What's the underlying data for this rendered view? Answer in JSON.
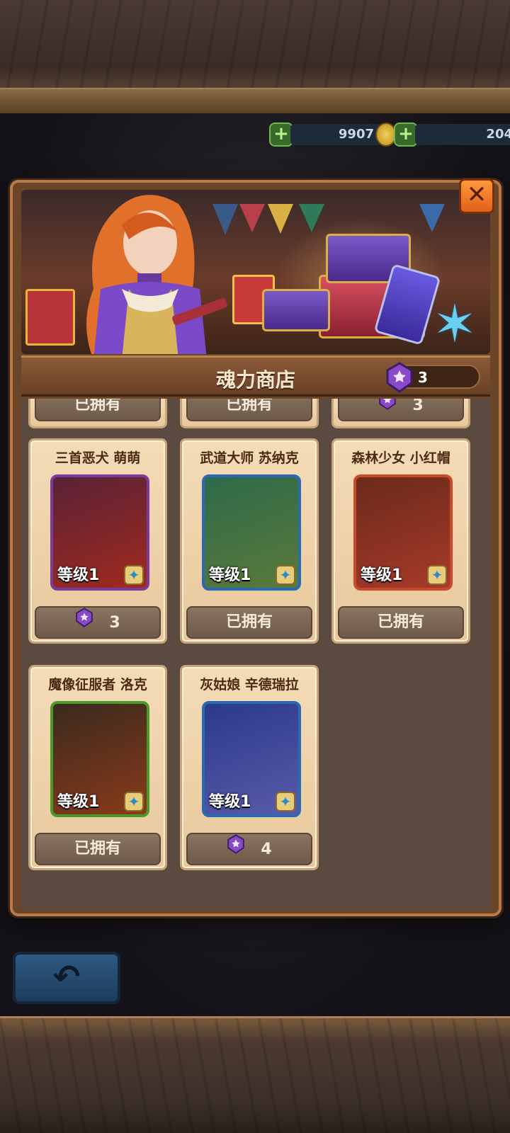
{
  "currency": {
    "gold": "9907",
    "gem": "204"
  },
  "shop": {
    "title": "魂力商店",
    "soul_count": "3"
  },
  "top_row": [
    {
      "price_label": "已拥有"
    },
    {
      "price_label": "已拥有"
    },
    {
      "price_label": "3",
      "has_gem": true
    }
  ],
  "heroes": [
    {
      "name": "三首恶犬 萌萌",
      "level": "等级1",
      "frame_color": "#7a3a9a",
      "price": "3",
      "owned": false,
      "scene": [
        "#5a2236",
        "#a02a1e"
      ]
    },
    {
      "name": "武道大师 苏纳克",
      "level": "等级1",
      "frame_color": "#2a6ab0",
      "price": "已拥有",
      "owned": true,
      "scene": [
        "#2e6a4a",
        "#5a7a3a"
      ]
    },
    {
      "name": "森林少女 小红帽",
      "level": "等级1",
      "frame_color": "#c84a2a",
      "price": "已拥有",
      "owned": true,
      "scene": [
        "#6a2a1a",
        "#a83a2a"
      ]
    },
    {
      "name": "魔像征服者 洛克",
      "level": "等级1",
      "frame_color": "#4a9a2a",
      "price": "已拥有",
      "owned": true,
      "scene": [
        "#3a2a1e",
        "#8a3a1a"
      ]
    },
    {
      "name": "灰姑娘 辛德瑞拉",
      "level": "等级1",
      "frame_color": "#2a6ab0",
      "price": "4",
      "owned": false,
      "scene": [
        "#2a3a8a",
        "#5a5aaa"
      ]
    }
  ]
}
